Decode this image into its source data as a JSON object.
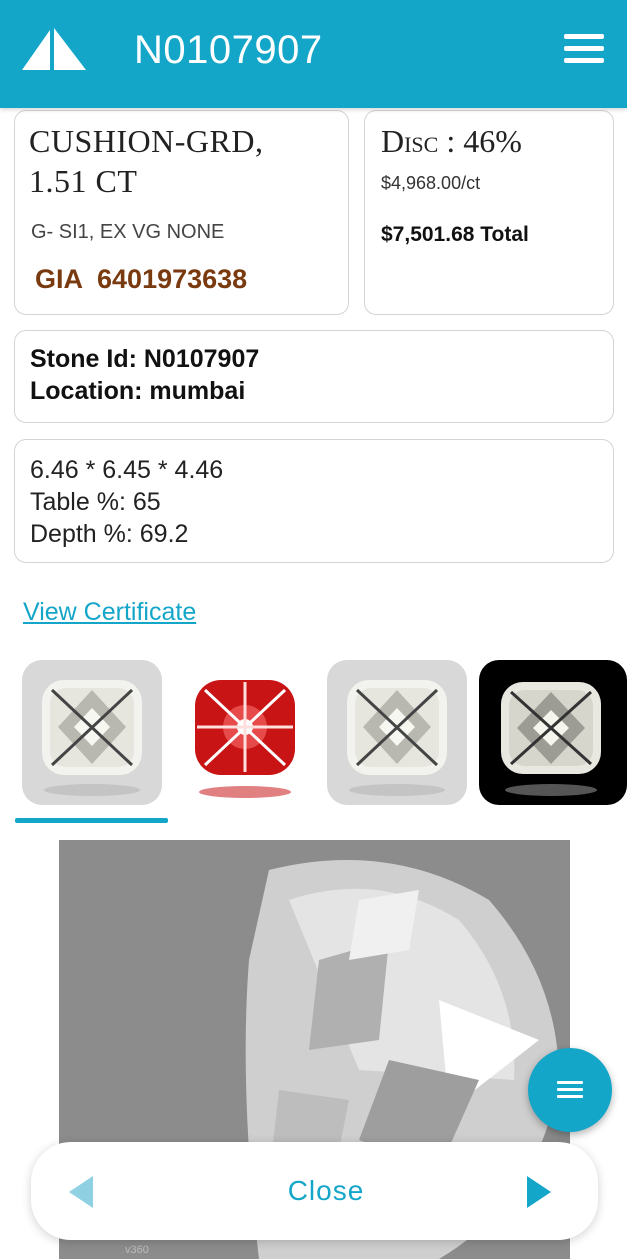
{
  "header": {
    "title": "N0107907",
    "logo_icon": "sail-logo-icon",
    "menu_icon": "hamburger-menu-icon",
    "background_color": "#14a6c9"
  },
  "summary": {
    "shape_line1": "CUSHION-GRD,",
    "shape_line2": "1.51 CT",
    "grade": "G- SI1, EX VG NONE",
    "lab": "GIA",
    "certificate_no": "6401973638"
  },
  "pricing": {
    "discount": "Disc : 46%",
    "per_carat": "$4,968.00/ct",
    "total": "$7,501.68 Total"
  },
  "stone": {
    "id_line": "Stone Id:  N0107907",
    "location_line": "Location:  mumbai"
  },
  "dimensions": {
    "measurements": "6.46 * 6.45 * 4.46",
    "table_line": "Table %:  65",
    "depth_line": "Depth %:  69.2"
  },
  "links": {
    "view_certificate": "View Certificate"
  },
  "thumbnails": [
    {
      "kind": "white-diamond-photo",
      "selected": true
    },
    {
      "kind": "red-heart-arrow-view",
      "selected": false
    },
    {
      "kind": "white-diamond-photo",
      "selected": false
    },
    {
      "kind": "dark-background-photo",
      "selected": false
    }
  ],
  "bottom_bar": {
    "close_label": "Close",
    "prev_icon": "triangle-left-icon",
    "next_icon": "triangle-right-icon"
  },
  "fab": {
    "icon": "hamburger-icon"
  },
  "colors": {
    "accent": "#14a6c9",
    "cert_color": "#7a3a10"
  }
}
